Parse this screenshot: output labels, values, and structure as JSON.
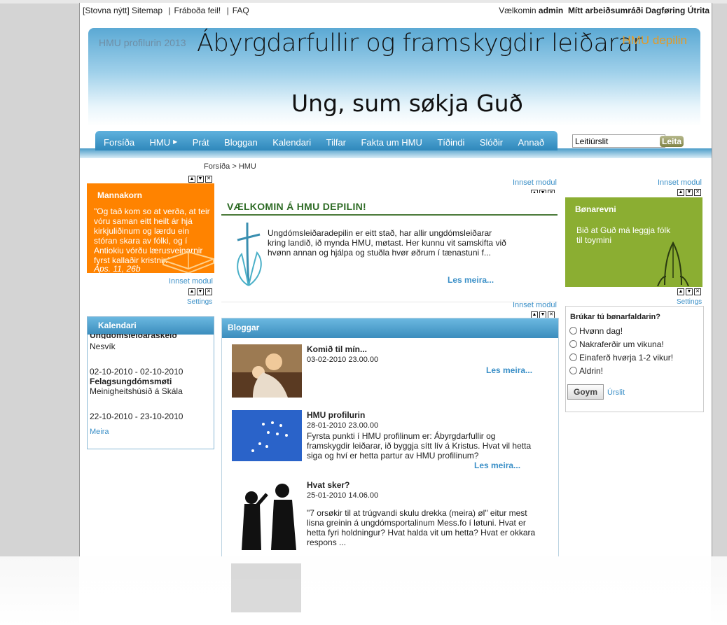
{
  "topbar": {
    "links": [
      "[Stovna nýtt]",
      "Sitemap",
      "Fráboða feil!",
      "FAQ"
    ],
    "welcome_prefix": "Vælkomin",
    "user": "admin",
    "workspace": "Mítt arbeiðsumráði",
    "update": "Dagføring",
    "exit": "Útrita"
  },
  "header": {
    "profil": "HMU profilurin 2013",
    "title": "Ábyrgdarfullir og framskygdir leiðarar",
    "depilin": "HMU depilin",
    "slogan": "Ung, sum søkja Guð"
  },
  "nav": {
    "items": [
      "Forsíða",
      "HMU",
      "Prát",
      "Bloggan",
      "Kalendari",
      "Tilfar",
      "Fakta um HMU",
      "Tíðindi",
      "Slóðir",
      "Annað"
    ],
    "has_submenu": "HMU"
  },
  "search": {
    "placeholder": "Leitiúrslit",
    "button": "Leita"
  },
  "breadcrumb": "Forsíða > HMU",
  "module_links": {
    "insert": "Innset modul",
    "settings": "Settings"
  },
  "mannakorn": {
    "title": "Mannakorn",
    "quote": "\"Og tað kom so at verða, at teir vóru saman eitt heilt ár hjá kirkjuliðinum og lærdu ein stóran skara av fólki, og í Antiokiu vórðu lærusveinarnir fyrst kallaðir kristnir.\"",
    "reference": "Áps. 11, 26b"
  },
  "kalendari": {
    "title": "Kalendari",
    "cut_top": "Ungdómsleiðaraskeið",
    "events": [
      {
        "place": "Nesvík"
      },
      {
        "date": "02-10-2010 - 02-10-2010",
        "name": "Felagsungdómsmøti",
        "place": "Meinigheitshúsið á Skála"
      },
      {
        "date": "22-10-2010 - 23-10-2010"
      }
    ],
    "more": "Meira"
  },
  "welcome": {
    "heading": "VÆLKOMIN Á HMU DEPILIN!",
    "text": "Ungdómsleiðaradepilin er eitt stað, har allir ungdómsleiðarar kring landið, ið mynda HMU, møtast. Her kunnu vit samskifta við hvønn annan og hjálpa og stuðla hvør øðrum í tænastuni f...",
    "more": "Les meira..."
  },
  "bloggar": {
    "title": "Bloggar",
    "posts": [
      {
        "title": "Komið til mín...",
        "date": "03-02-2010 23.00.00",
        "text": "",
        "more": "Les meira..."
      },
      {
        "title": "HMU profilurin",
        "date": "28-01-2010 23.00.00",
        "text": "Fyrsta punkti í HMU profilinum er: Ábyrgdarfullir og framskygdir leiðarar, ið byggja sítt lív á Kristus. Hvat vil hetta siga og hví er hetta partur av HMU profilinum?",
        "more": "Les meira..."
      },
      {
        "title": "Hvat sker?",
        "date": "25-01-2010 14.06.00",
        "text": "\"7 orsøkir til at trúgvandi skulu drekka (meira) øl\" eitur mest lisna greinin á ungdómsportalinum Mess.fo í løtuni. Hvat er hetta fyri holdningur? Hvat halda vit um hetta? Hvat er okkara respons ...",
        "more": ""
      }
    ]
  },
  "bonarevni": {
    "title": "Bønarevni",
    "text": "Bið at Guð má leggja fólk til toymini"
  },
  "poll": {
    "question": "Brúkar tú bønarfaldarin?",
    "options": [
      "Hvønn dag!",
      "Nakraferðir um vikuna!",
      "Einaferð hvørja 1-2 vikur!",
      "Aldrin!"
    ],
    "vote": "Goym",
    "results": "Úrslit"
  },
  "colors": {
    "accent_blue": "#3a8fc7",
    "orange": "#ff8300",
    "green": "#8bae32",
    "header_gold": "#e69a23"
  }
}
